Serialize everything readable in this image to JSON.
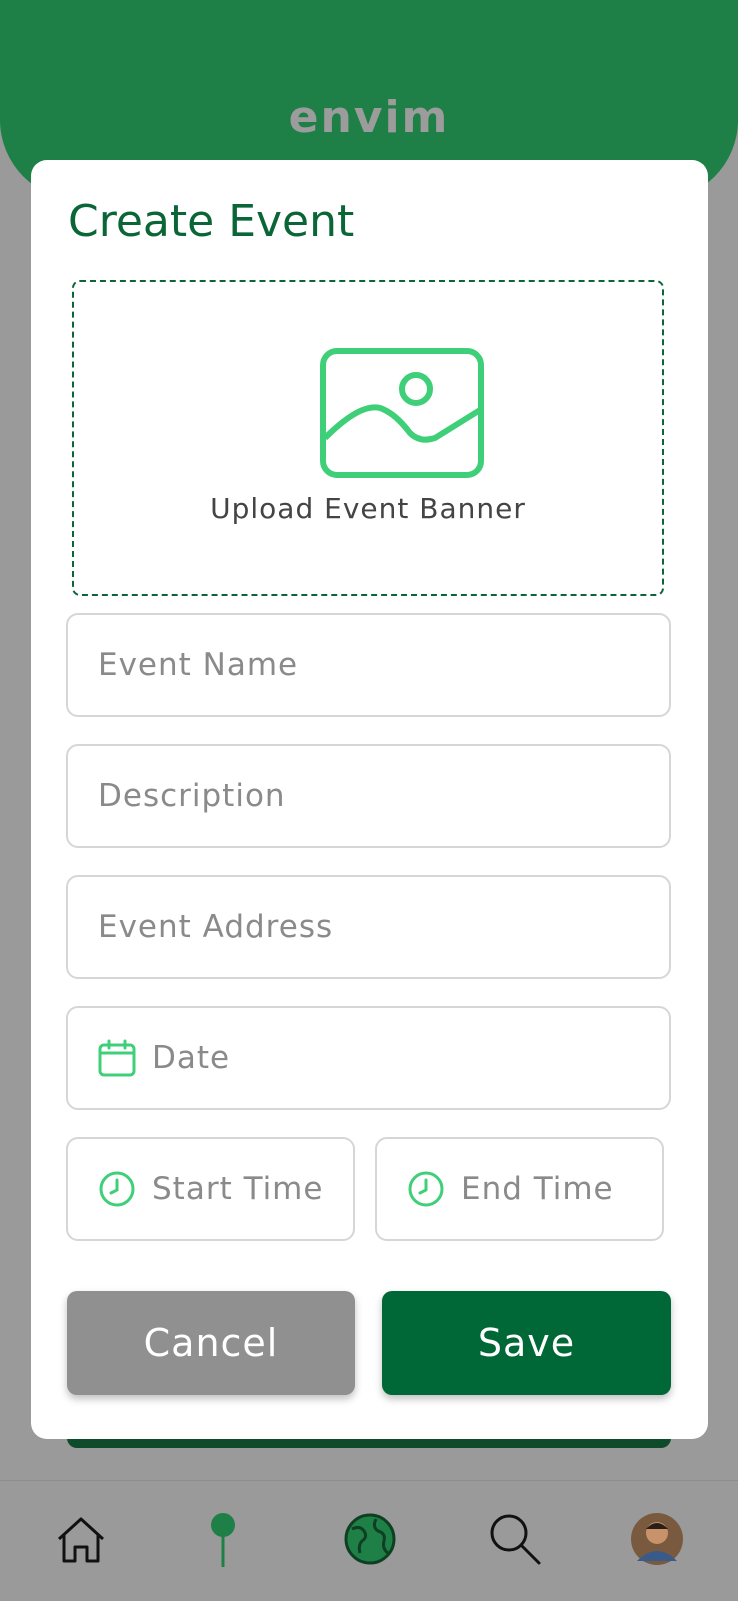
{
  "app": {
    "logo_text": "envim"
  },
  "modal": {
    "title": "Create Event",
    "upload": {
      "label": "Upload Event Banner",
      "icon": "image-icon"
    },
    "fields": {
      "event_name": {
        "placeholder": "Event Name"
      },
      "description": {
        "placeholder": "Description"
      },
      "event_address": {
        "placeholder": "Event Address"
      },
      "date": {
        "placeholder": "Date",
        "icon": "calendar-icon"
      },
      "start_time": {
        "placeholder": "Start Time",
        "icon": "clock-icon"
      },
      "end_time": {
        "placeholder": "End Time",
        "icon": "clock-icon"
      }
    },
    "buttons": {
      "cancel": "Cancel",
      "save": "Save"
    }
  },
  "bottom_nav": {
    "items": [
      {
        "icon": "home-icon"
      },
      {
        "icon": "pin-icon"
      },
      {
        "icon": "globe-icon"
      },
      {
        "icon": "search-icon"
      },
      {
        "icon": "avatar"
      }
    ]
  },
  "colors": {
    "brand_green": "#1e8046",
    "dark_green": "#006837",
    "accent_green": "#3fcf78",
    "cancel_gray": "#909090"
  }
}
